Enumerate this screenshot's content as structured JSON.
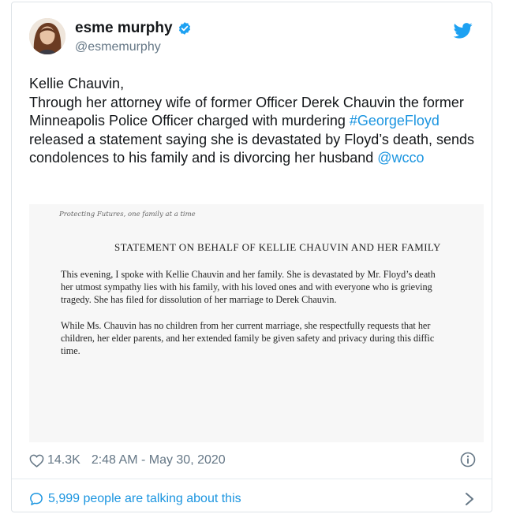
{
  "tweet": {
    "author": {
      "name": "esme murphy",
      "handle": "@esmemurphy"
    },
    "text": {
      "line1": "Kellie Chauvin,",
      "part1": "Through her attorney wife of former Officer Derek Chauvin the former Minneapolis Police Officer charged with murdering ",
      "hashtag": "#GeorgeFloyd",
      "part2": " released a statement saying she is devastated by Floyd’s death, sends condolences to his family and is divorcing her husband ",
      "mention": "@wcco"
    },
    "media": {
      "tagline": "Protecting Futures, one family at a time",
      "title": "STATEMENT ON BEHALF OF KELLIE CHAUVIN AND HER FAMILY",
      "para1": [
        "This evening, I spoke with Kellie Chauvin and her family. She is devastated by Mr. Floyd’s death",
        "her utmost sympathy lies with his family, with his loved ones and with everyone who is grieving",
        "tragedy. She has filed for dissolution of her marriage to Derek Chauvin."
      ],
      "para2": [
        "While Ms. Chauvin has no children from her current marriage, she respectfully requests that her",
        "children, her elder parents, and her extended family be given safety and privacy during this diffic",
        "time."
      ]
    },
    "likes": "14.3K",
    "timestamp": "2:48 AM - May 30, 2020",
    "talking": "5,999 people are talking about this"
  },
  "icons": [
    "verified-badge-icon",
    "twitter-bird-icon",
    "heart-icon",
    "info-icon",
    "comment-bubble-icon",
    "chevron-right-icon"
  ],
  "colors": {
    "link": "#1b95e0",
    "secondary": "#657786",
    "text": "#14171a"
  }
}
